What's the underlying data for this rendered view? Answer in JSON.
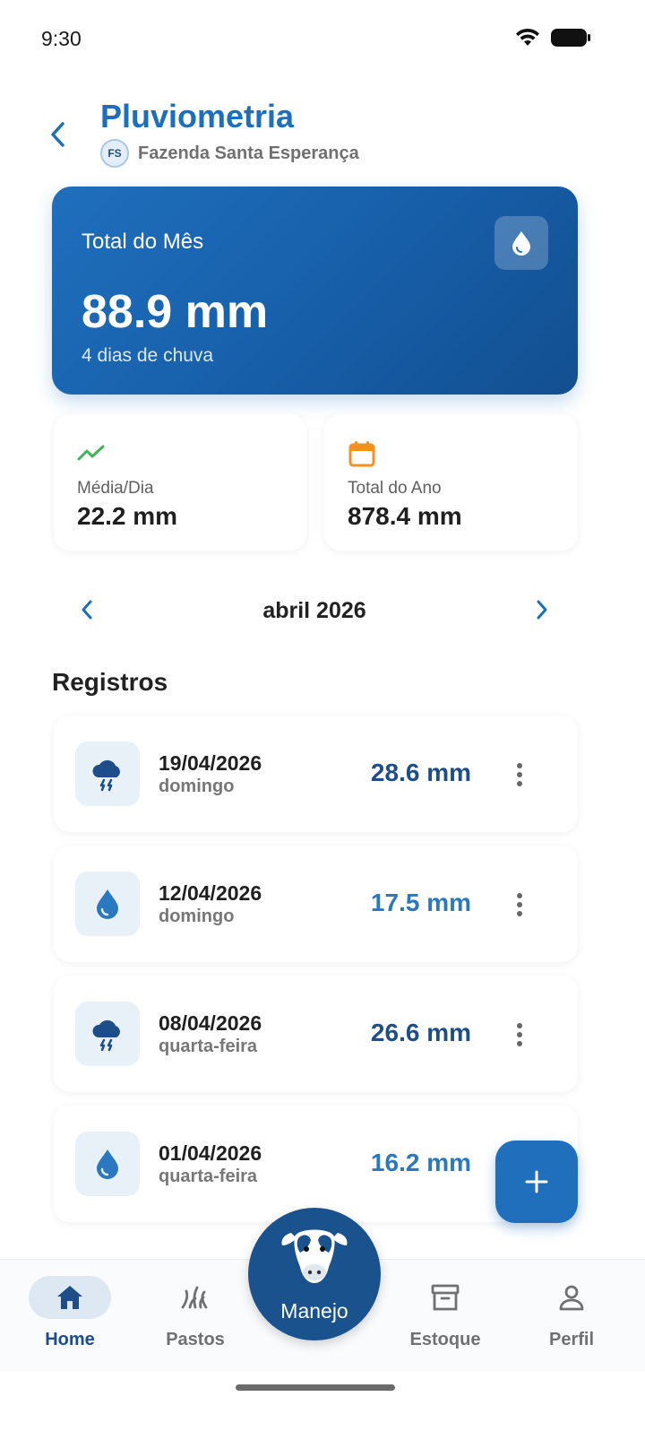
{
  "status": {
    "time": "9:30"
  },
  "header": {
    "title": "Pluviometria",
    "farm_initials": "FS",
    "farm_name": "Fazenda Santa Esperança"
  },
  "month_summary": {
    "label": "Total do Mês",
    "value": "88.9 mm",
    "rain_days": "4 dias de chuva"
  },
  "stats": {
    "avg_label": "Média/Dia",
    "avg_value": "22.2 mm",
    "year_label": "Total do Ano",
    "year_value": "878.4 mm"
  },
  "month_nav": {
    "label": "abril 2026"
  },
  "records_title": "Registros",
  "records": [
    {
      "date": "19/04/2026",
      "weekday": "domingo",
      "amount": "28.6 mm",
      "icon": "storm-cloud-icon",
      "amount_color": "#1d4e8a"
    },
    {
      "date": "12/04/2026",
      "weekday": "domingo",
      "amount": "17.5 mm",
      "icon": "water-drop-icon",
      "amount_color": "#2a78bf"
    },
    {
      "date": "08/04/2026",
      "weekday": "quarta-feira",
      "amount": "26.6 mm",
      "icon": "storm-cloud-icon",
      "amount_color": "#1d4e8a"
    },
    {
      "date": "01/04/2026",
      "weekday": "quarta-feira",
      "amount": "16.2 mm",
      "icon": "water-drop-icon",
      "amount_color": "#2a78bf"
    }
  ],
  "bottom_nav": {
    "home": "Home",
    "pastos": "Pastos",
    "manejo": "Manejo",
    "estoque": "Estoque",
    "perfil": "Perfil"
  },
  "colors": {
    "primary": "#1f6fbd",
    "dark_blue": "#1a528d",
    "green": "#3fb35a",
    "orange": "#f5901e"
  }
}
